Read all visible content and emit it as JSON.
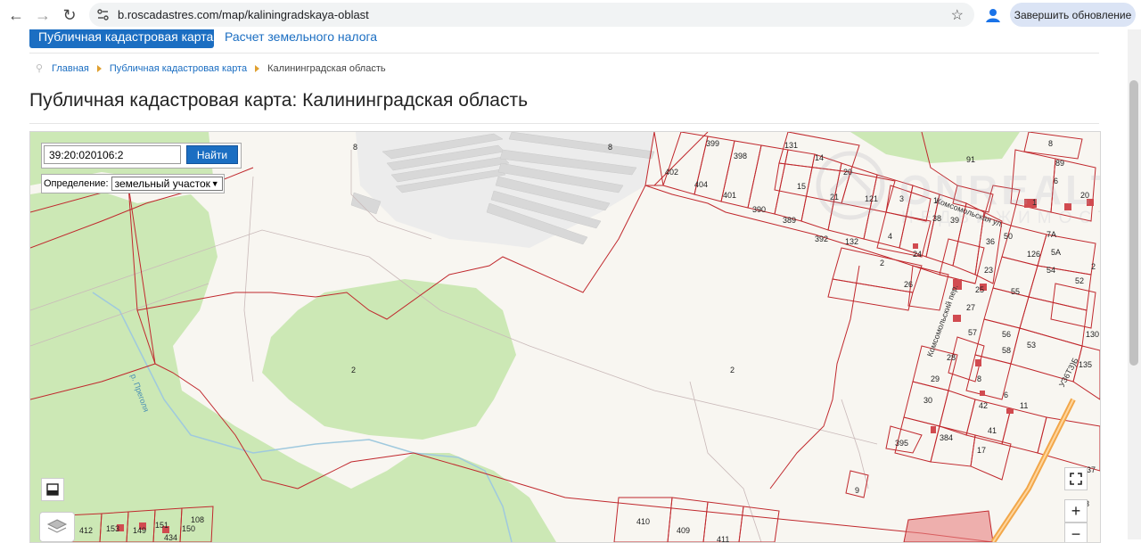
{
  "browser": {
    "url": "b.roscadastres.com/map/kaliningradskaya-oblast",
    "update_button": "Завершить обновление"
  },
  "site_nav": {
    "active_tab": "Публичная кадастровая карта",
    "tax_link": "Расчет земельного налога"
  },
  "breadcrumb": {
    "items": [
      "Главная",
      "Публичная кадастровая карта",
      "Калининградская область"
    ]
  },
  "page_title": "Публичная кадастровая карта: Калининградская область",
  "map": {
    "search_value": "39:20:020106:2",
    "search_button": "Найти",
    "definition_label": "Определение:",
    "definition_value": "земельный участок",
    "zoom_in": "+",
    "zoom_out": "−",
    "parcel_labels": [
      "8",
      "8",
      "402",
      "404",
      "401",
      "399",
      "398",
      "390",
      "389",
      "131",
      "14",
      "20",
      "15",
      "21",
      "121",
      "3",
      "1",
      "38",
      "39",
      "392",
      "132",
      "2",
      "4",
      "24",
      "26",
      "91",
      "1",
      "36",
      "50",
      "126",
      "25",
      "23",
      "55",
      "54",
      "52",
      "27",
      "57",
      "56",
      "58",
      "53",
      "130",
      "135",
      "28",
      "8",
      "29",
      "6",
      "30",
      "42",
      "41",
      "17",
      "11",
      "395",
      "384",
      "2",
      "2",
      "9",
      "410",
      "409",
      "411",
      "412",
      "153",
      "149",
      "151",
      "434",
      "150",
      "108",
      "37",
      "8",
      "89",
      "7A",
      "5A",
      "2",
      "6",
      "20",
      "43",
      "52",
      "37"
    ],
    "street_labels": [
      "Комсомольский пер.",
      "Комсомольская ул.",
      "р. Преголя",
      "УЗ6ТЗ)Б"
    ],
    "watermark_text": "ONREALT",
    "watermark_sub": "НЕДВИЖИМОСТЬ"
  },
  "colors": {
    "accent": "#1b6ec2",
    "parcel_border": "#c0282d",
    "forest": "#cce8b5",
    "map_bg": "#f8f6f1",
    "building": "#d8d8d8"
  }
}
